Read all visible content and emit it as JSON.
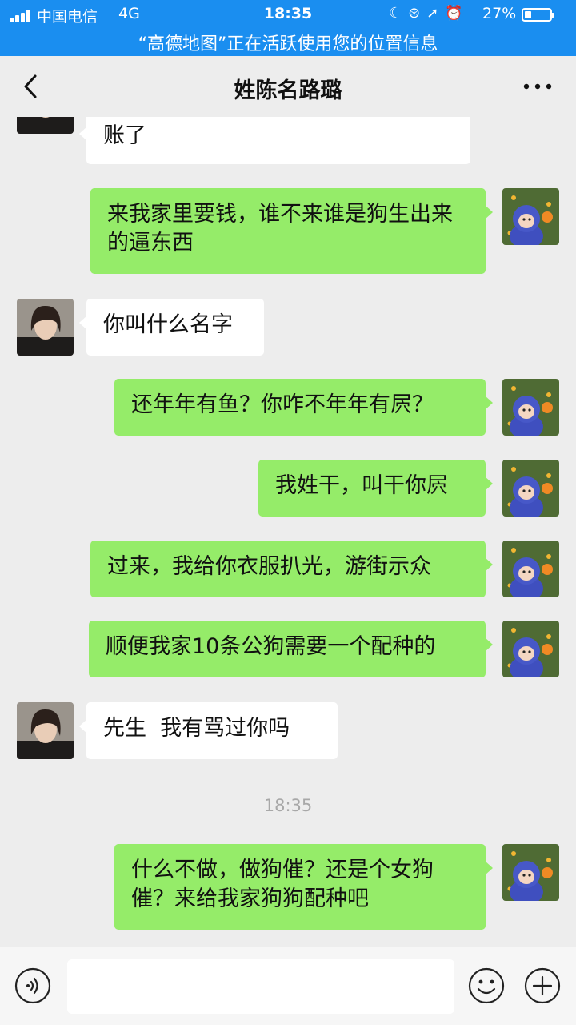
{
  "status_bar": {
    "carrier": "中国电信",
    "network": "4G",
    "time": "18:35",
    "battery_percent": "27%",
    "battery_level": 0.27,
    "location_banner": "“高德地图”正在活跃使用您的位置信息",
    "icons": [
      "moon-icon",
      "rotation-lock-icon",
      "location-arrow-icon",
      "alarm-icon"
    ]
  },
  "nav": {
    "title": "姓陈名路璐",
    "back_icon": "chevron-left-icon",
    "more_icon": "more-dots-icon"
  },
  "messages": [
    {
      "side": "left",
      "text": "账了"
    },
    {
      "side": "right",
      "text": "来我家里要钱，谁不来谁是狗生出来的逼东西"
    },
    {
      "side": "left",
      "text": "你叫什么名字"
    },
    {
      "side": "right",
      "text": "还年年有鱼？你咋不年年有屄？"
    },
    {
      "side": "right",
      "text": "我姓干，叫干你屄"
    },
    {
      "side": "right",
      "text": "过来，我给你衣服扒光，游街示众"
    },
    {
      "side": "right",
      "text": "顺便我家10条公狗需要一个配种的"
    },
    {
      "side": "left",
      "text": "先生  我有骂过你吗"
    },
    {
      "type": "time",
      "text": "18:35"
    },
    {
      "side": "right",
      "text": "什么不做，做狗催？还是个女狗催？来给我家狗狗配种吧"
    }
  ],
  "input_bar": {
    "placeholder": "",
    "value": "",
    "icons": [
      "voice-icon",
      "emoji-icon",
      "plus-icon"
    ]
  },
  "colors": {
    "status_bar": "#1a8ef0",
    "sent_bubble": "#95ec69",
    "received_bubble": "#ffffff",
    "background": "#ededed"
  }
}
